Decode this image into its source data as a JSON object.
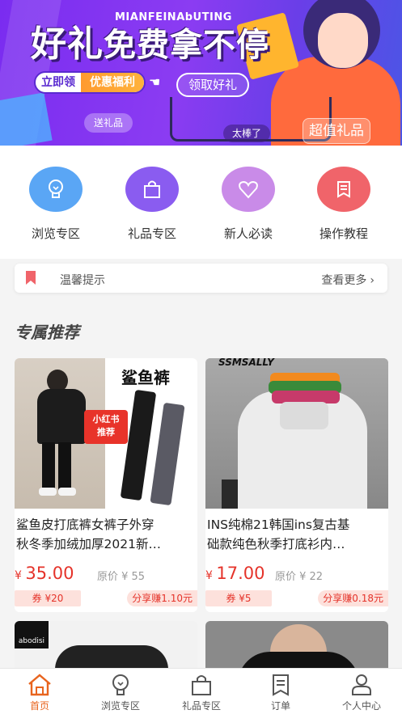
{
  "banner": {
    "title_a": "好礼",
    "title_b": "免费拿不停",
    "pinyin": "MIANFEINAbUTING",
    "pill_left": "立即领",
    "pill_right": "优惠福利",
    "get_button": "领取好礼",
    "tag_gift": "送礼品",
    "tag_great": "太棒了",
    "tag_value": "超值礼品"
  },
  "categories": [
    {
      "label": "浏览专区",
      "color": "#5aa6f5",
      "icon": "bulb-icon"
    },
    {
      "label": "礼品专区",
      "color": "#8a5cf0",
      "icon": "bag-icon"
    },
    {
      "label": "新人必读",
      "color": "#c98be8",
      "icon": "heart-icon"
    },
    {
      "label": "操作教程",
      "color": "#f0646a",
      "icon": "doc-icon"
    }
  ],
  "notice": {
    "text": "温馨提示",
    "more": "查看更多"
  },
  "section_title": "专属推荐",
  "products": [
    {
      "line1": "鲨鱼皮打底裤女裤子外穿",
      "line2": "秋冬季加绒加厚2021新…",
      "currency": "¥",
      "price": "35.00",
      "original": "原价 ¥ 55",
      "coupon": "券 ¥20",
      "share": "分享赚1.10元",
      "img_title": "鲨鱼裤",
      "img_badge_top": "小红书",
      "img_badge_bottom": "推荐"
    },
    {
      "line1": "INS纯棉21韩国ins复古基",
      "line2": "础款纯色秋季打底衫内…",
      "currency": "¥",
      "price": "17.00",
      "original": "原价 ¥ 22",
      "coupon": "券 ¥5",
      "share": "分享赚0.18元",
      "img_brand": "SSMSALLY"
    }
  ],
  "next_card": {
    "brand": "abodisi"
  },
  "tabbar": [
    {
      "label": "首页",
      "icon": "home-icon"
    },
    {
      "label": "浏览专区",
      "icon": "bulb-icon"
    },
    {
      "label": "礼品专区",
      "icon": "bag-icon"
    },
    {
      "label": "订单",
      "icon": "order-icon"
    },
    {
      "label": "个人中心",
      "icon": "user-icon"
    }
  ]
}
